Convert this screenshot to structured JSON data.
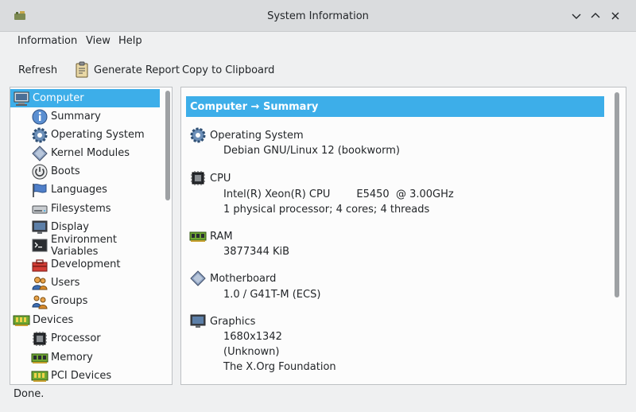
{
  "window": {
    "title": "System Information"
  },
  "menu": [
    "Information",
    "View",
    "Help"
  ],
  "toolbar": {
    "refresh": "Refresh",
    "generate_report": "Generate Report",
    "copy_clipboard": "Copy to Clipboard"
  },
  "tree": [
    {
      "label": "Computer",
      "icon": "computer-icon"
    },
    {
      "label": "Summary",
      "icon": "info-icon"
    },
    {
      "label": "Operating System",
      "icon": "gear-icon"
    },
    {
      "label": "Kernel Modules",
      "icon": "module-icon"
    },
    {
      "label": "Boots",
      "icon": "power-icon"
    },
    {
      "label": "Languages",
      "icon": "flag-icon"
    },
    {
      "label": "Filesystems",
      "icon": "drive-icon"
    },
    {
      "label": "Display",
      "icon": "monitor-icon"
    },
    {
      "label": "Environment Variables",
      "icon": "terminal-icon"
    },
    {
      "label": "Development",
      "icon": "toolbox-icon"
    },
    {
      "label": "Users",
      "icon": "users-icon"
    },
    {
      "label": "Groups",
      "icon": "groups-icon"
    },
    {
      "label": "Devices",
      "icon": "board-icon"
    },
    {
      "label": "Processor",
      "icon": "cpu-icon"
    },
    {
      "label": "Memory",
      "icon": "ram-icon"
    },
    {
      "label": "PCI Devices",
      "icon": "board-icon"
    }
  ],
  "detail": {
    "header": "Computer → Summary",
    "sections": [
      {
        "title": "Operating System",
        "icon": "gear-icon",
        "lines": [
          "Debian GNU/Linux 12 (bookworm)"
        ]
      },
      {
        "title": "CPU",
        "icon": "cpu-icon",
        "lines": [
          "Intel(R) Xeon(R) CPU        E5450  @ 3.00GHz",
          "1 physical processor; 4 cores; 4 threads"
        ]
      },
      {
        "title": "RAM",
        "icon": "ram-icon",
        "lines": [
          "3877344 KiB"
        ]
      },
      {
        "title": "Motherboard",
        "icon": "module-icon",
        "lines": [
          "1.0 / G41T-M (ECS)"
        ]
      },
      {
        "title": "Graphics",
        "icon": "monitor-icon",
        "lines": [
          "1680x1342",
          "(Unknown)",
          "The X.Org Foundation"
        ]
      }
    ]
  },
  "status": "Done."
}
